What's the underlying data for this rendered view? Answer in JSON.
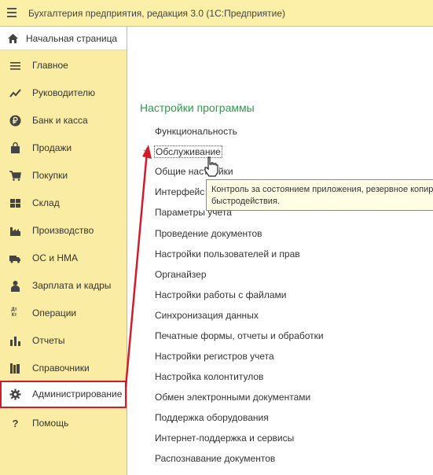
{
  "window": {
    "title": "Бухгалтерия предприятия, редакция 3.0  (1С:Предприятие)"
  },
  "home_tab": {
    "label": "Начальная страница"
  },
  "sidebar": {
    "items": [
      {
        "label": "Главное",
        "icon": "list-icon"
      },
      {
        "label": "Руководителю",
        "icon": "trend-icon"
      },
      {
        "label": "Банк и касса",
        "icon": "ruble-icon"
      },
      {
        "label": "Продажи",
        "icon": "bag-icon"
      },
      {
        "label": "Покупки",
        "icon": "cart-icon"
      },
      {
        "label": "Склад",
        "icon": "warehouse-icon"
      },
      {
        "label": "Производство",
        "icon": "factory-icon"
      },
      {
        "label": "ОС и НМА",
        "icon": "truck-icon"
      },
      {
        "label": "Зарплата и кадры",
        "icon": "person-icon"
      },
      {
        "label": "Операции",
        "icon": "dt-kt-icon"
      },
      {
        "label": "Отчеты",
        "icon": "bar-chart-icon"
      },
      {
        "label": "Справочники",
        "icon": "books-icon"
      },
      {
        "label": "Администрирование",
        "icon": "gear-icon",
        "active": true
      },
      {
        "label": "Помощь",
        "icon": "help-icon"
      }
    ],
    "dt_kt_glyph": "Дт Кт",
    "help_glyph": "?"
  },
  "main": {
    "section_title": "Настройки программы",
    "links": [
      "Функциональность",
      "Обслуживание",
      "Общие настройки",
      "Интерфейс",
      "Параметры учета",
      "Проведение документов",
      "Настройки пользователей и прав",
      "Органайзер",
      "Настройки работы с файлами",
      "Синхронизация данных",
      "Печатные формы, отчеты и обработки",
      "Настройки регистров учета",
      "Настройка колонтитулов",
      "Обмен электронными документами",
      "Поддержка оборудования",
      "Интернет-поддержка и сервисы",
      "Распознавание документов"
    ],
    "star": "★"
  },
  "tooltip": {
    "line1": "Контроль за состоянием приложения, резервное копир",
    "line2": "быстродействия."
  },
  "colors": {
    "accent_green": "#2e9a4b",
    "highlight_red": "#d21c2a",
    "sidebar_bg": "#fbeca3"
  }
}
